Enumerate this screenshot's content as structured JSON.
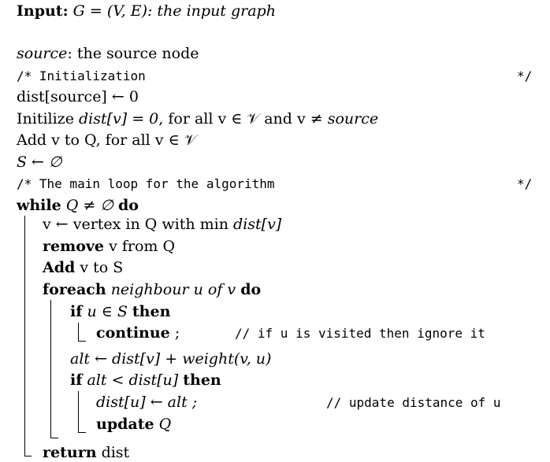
{
  "algorithm": {
    "input_kw": "Input:",
    "input_text": "G = (V, E): the input graph",
    "source_var": "source",
    "source_text": ": the source node",
    "comment_init": "/* Initialization",
    "comment_close_1": "*/",
    "line_dist_source": "dist[source] ← 0",
    "init_prefix": "Initilize ",
    "init_math1": "dist[v] = 0",
    "init_mid": ", for all v ∈ 𝒱 and v ≠ ",
    "init_source": "source",
    "add_q": "Add v to Q, for all v ∈ 𝒱",
    "s_empty": "S ← ∅",
    "comment_main": "/* The main loop for the algorithm",
    "comment_close_2": "*/",
    "while_kw": "while",
    "while_cond": "Q ≠ ∅",
    "do_kw": "do",
    "v_assign_a": "v ← vertex in Q with min ",
    "v_assign_b": "dist[v]",
    "remove_kw": "remove",
    "remove_rest": "v from Q",
    "add_kw": "Add",
    "add_rest": "v to S",
    "foreach_kw": "foreach",
    "foreach_mid": "neighbour u of v",
    "foreach_do": "do",
    "if1_kw": "if",
    "if1_cond": "u ∈ S",
    "then1_kw": "then",
    "continue_kw": "continue",
    "continue_semi": ";",
    "comment_continue": "// if u is visited then ignore it",
    "alt_assign": "alt ← dist[v] + weight(v, u)",
    "if2_kw": "if",
    "if2_cond": "alt < dist[u]",
    "then2_kw": "then",
    "dist_update": "dist[u] ← alt ;",
    "comment_update": "// update distance of u",
    "update_kw": "update",
    "update_q": "Q",
    "return_kw": "return",
    "return_val": "dist"
  }
}
